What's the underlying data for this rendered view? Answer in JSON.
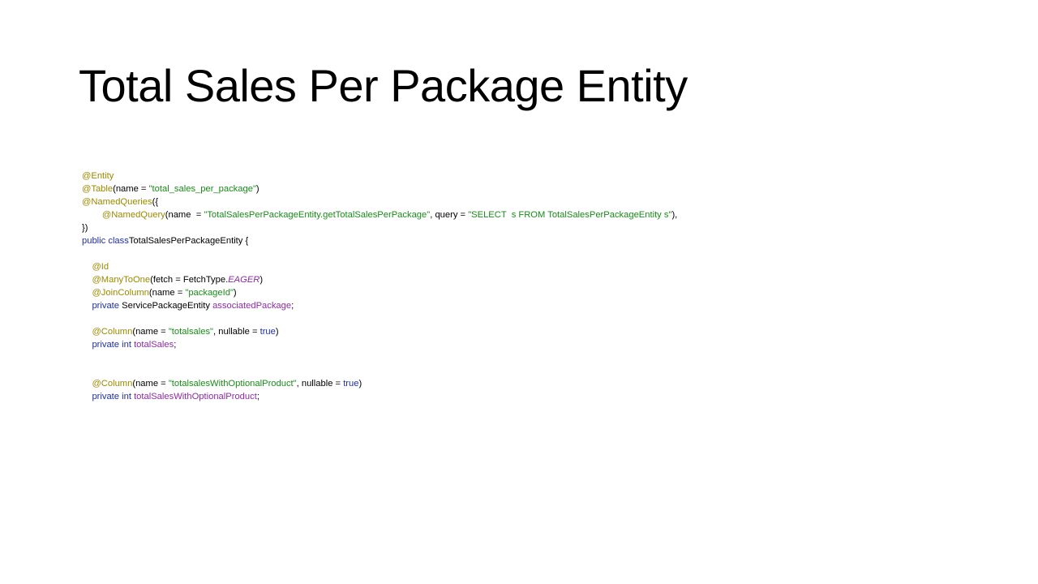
{
  "slide": {
    "title": "Total Sales Per Package Entity"
  },
  "code": {
    "lines": [
      [
        {
          "t": "@Entity",
          "c": "annotation"
        }
      ],
      [
        {
          "t": "@Table",
          "c": "annotation"
        },
        {
          "t": "(name = ",
          "c": "plain"
        },
        {
          "t": "\"total_sales_per_package\"",
          "c": "string"
        },
        {
          "t": ")",
          "c": "plain"
        }
      ],
      [
        {
          "t": "@NamedQueries",
          "c": "annotation"
        },
        {
          "t": "({",
          "c": "plain"
        }
      ],
      [
        {
          "t": "        ",
          "c": "plain"
        },
        {
          "t": "@NamedQuery",
          "c": "annotation"
        },
        {
          "t": "(name  = ",
          "c": "plain"
        },
        {
          "t": "\"TotalSalesPerPackageEntity.getTotalSalesPerPackage\"",
          "c": "string"
        },
        {
          "t": ", query = ",
          "c": "plain"
        },
        {
          "t": "\"SELECT  s FROM TotalSalesPerPackageEntity s\"",
          "c": "string"
        },
        {
          "t": "),",
          "c": "plain"
        }
      ],
      [
        {
          "t": "})",
          "c": "plain"
        }
      ],
      [
        {
          "t": "public",
          "c": "keyword"
        },
        {
          "t": " ",
          "c": "plain"
        },
        {
          "t": "class",
          "c": "keyword"
        },
        {
          "t": "TotalSalesPerPackageEntity {",
          "c": "plain"
        }
      ],
      [],
      [
        {
          "t": "    ",
          "c": "plain"
        },
        {
          "t": "@Id",
          "c": "annotation"
        }
      ],
      [
        {
          "t": "    ",
          "c": "plain"
        },
        {
          "t": "@ManyToOne",
          "c": "annotation"
        },
        {
          "t": "(fetch = FetchType.",
          "c": "plain"
        },
        {
          "t": "EAGER",
          "c": "italic"
        },
        {
          "t": ")",
          "c": "plain"
        }
      ],
      [
        {
          "t": "    ",
          "c": "plain"
        },
        {
          "t": "@JoinColumn",
          "c": "annotation"
        },
        {
          "t": "(name = ",
          "c": "plain"
        },
        {
          "t": "\"packageId\"",
          "c": "string"
        },
        {
          "t": ")",
          "c": "plain"
        }
      ],
      [
        {
          "t": "    ",
          "c": "plain"
        },
        {
          "t": "private",
          "c": "keyword"
        },
        {
          "t": " ServicePackageEntity ",
          "c": "plain"
        },
        {
          "t": "associatedPackage",
          "c": "field"
        },
        {
          "t": ";",
          "c": "plain"
        }
      ],
      [],
      [
        {
          "t": "    ",
          "c": "plain"
        },
        {
          "t": "@Column",
          "c": "annotation"
        },
        {
          "t": "(name = ",
          "c": "plain"
        },
        {
          "t": "\"totalsales\"",
          "c": "string"
        },
        {
          "t": ", nullable = ",
          "c": "plain"
        },
        {
          "t": "true",
          "c": "keyword"
        },
        {
          "t": ")",
          "c": "plain"
        }
      ],
      [
        {
          "t": "    ",
          "c": "plain"
        },
        {
          "t": "private",
          "c": "keyword"
        },
        {
          "t": " ",
          "c": "plain"
        },
        {
          "t": "int",
          "c": "keyword"
        },
        {
          "t": " ",
          "c": "plain"
        },
        {
          "t": "totalSales",
          "c": "field"
        },
        {
          "t": ";",
          "c": "plain"
        }
      ],
      [],
      [],
      [
        {
          "t": "    ",
          "c": "plain"
        },
        {
          "t": "@Column",
          "c": "annotation"
        },
        {
          "t": "(name = ",
          "c": "plain"
        },
        {
          "t": "\"totalsalesWithOptionalProduct\"",
          "c": "string"
        },
        {
          "t": ", nullable = ",
          "c": "plain"
        },
        {
          "t": "true",
          "c": "keyword"
        },
        {
          "t": ")",
          "c": "plain"
        }
      ],
      [
        {
          "t": "    ",
          "c": "plain"
        },
        {
          "t": "private",
          "c": "keyword"
        },
        {
          "t": " ",
          "c": "plain"
        },
        {
          "t": "int",
          "c": "keyword"
        },
        {
          "t": " ",
          "c": "plain"
        },
        {
          "t": "totalSalesWithOptionalProduct",
          "c": "field"
        },
        {
          "t": ";",
          "c": "plain"
        }
      ]
    ]
  }
}
